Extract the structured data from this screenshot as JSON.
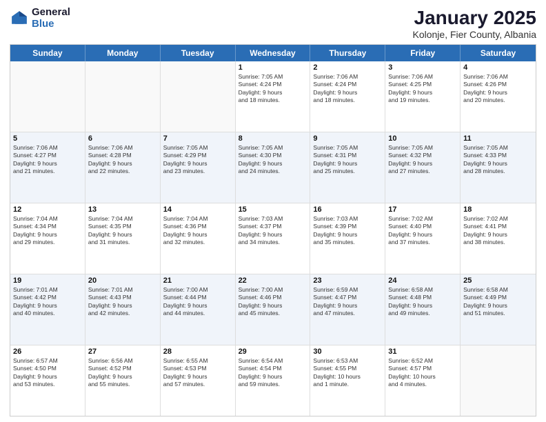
{
  "logo": {
    "general": "General",
    "blue": "Blue"
  },
  "header": {
    "month": "January 2025",
    "location": "Kolonje, Fier County, Albania"
  },
  "weekdays": [
    "Sunday",
    "Monday",
    "Tuesday",
    "Wednesday",
    "Thursday",
    "Friday",
    "Saturday"
  ],
  "rows": [
    {
      "alt": false,
      "cells": [
        {
          "day": "",
          "info": ""
        },
        {
          "day": "",
          "info": ""
        },
        {
          "day": "",
          "info": ""
        },
        {
          "day": "1",
          "info": "Sunrise: 7:05 AM\nSunset: 4:24 PM\nDaylight: 9 hours\nand 18 minutes."
        },
        {
          "day": "2",
          "info": "Sunrise: 7:06 AM\nSunset: 4:24 PM\nDaylight: 9 hours\nand 18 minutes."
        },
        {
          "day": "3",
          "info": "Sunrise: 7:06 AM\nSunset: 4:25 PM\nDaylight: 9 hours\nand 19 minutes."
        },
        {
          "day": "4",
          "info": "Sunrise: 7:06 AM\nSunset: 4:26 PM\nDaylight: 9 hours\nand 20 minutes."
        }
      ]
    },
    {
      "alt": true,
      "cells": [
        {
          "day": "5",
          "info": "Sunrise: 7:06 AM\nSunset: 4:27 PM\nDaylight: 9 hours\nand 21 minutes."
        },
        {
          "day": "6",
          "info": "Sunrise: 7:06 AM\nSunset: 4:28 PM\nDaylight: 9 hours\nand 22 minutes."
        },
        {
          "day": "7",
          "info": "Sunrise: 7:05 AM\nSunset: 4:29 PM\nDaylight: 9 hours\nand 23 minutes."
        },
        {
          "day": "8",
          "info": "Sunrise: 7:05 AM\nSunset: 4:30 PM\nDaylight: 9 hours\nand 24 minutes."
        },
        {
          "day": "9",
          "info": "Sunrise: 7:05 AM\nSunset: 4:31 PM\nDaylight: 9 hours\nand 25 minutes."
        },
        {
          "day": "10",
          "info": "Sunrise: 7:05 AM\nSunset: 4:32 PM\nDaylight: 9 hours\nand 27 minutes."
        },
        {
          "day": "11",
          "info": "Sunrise: 7:05 AM\nSunset: 4:33 PM\nDaylight: 9 hours\nand 28 minutes."
        }
      ]
    },
    {
      "alt": false,
      "cells": [
        {
          "day": "12",
          "info": "Sunrise: 7:04 AM\nSunset: 4:34 PM\nDaylight: 9 hours\nand 29 minutes."
        },
        {
          "day": "13",
          "info": "Sunrise: 7:04 AM\nSunset: 4:35 PM\nDaylight: 9 hours\nand 31 minutes."
        },
        {
          "day": "14",
          "info": "Sunrise: 7:04 AM\nSunset: 4:36 PM\nDaylight: 9 hours\nand 32 minutes."
        },
        {
          "day": "15",
          "info": "Sunrise: 7:03 AM\nSunset: 4:37 PM\nDaylight: 9 hours\nand 34 minutes."
        },
        {
          "day": "16",
          "info": "Sunrise: 7:03 AM\nSunset: 4:39 PM\nDaylight: 9 hours\nand 35 minutes."
        },
        {
          "day": "17",
          "info": "Sunrise: 7:02 AM\nSunset: 4:40 PM\nDaylight: 9 hours\nand 37 minutes."
        },
        {
          "day": "18",
          "info": "Sunrise: 7:02 AM\nSunset: 4:41 PM\nDaylight: 9 hours\nand 38 minutes."
        }
      ]
    },
    {
      "alt": true,
      "cells": [
        {
          "day": "19",
          "info": "Sunrise: 7:01 AM\nSunset: 4:42 PM\nDaylight: 9 hours\nand 40 minutes."
        },
        {
          "day": "20",
          "info": "Sunrise: 7:01 AM\nSunset: 4:43 PM\nDaylight: 9 hours\nand 42 minutes."
        },
        {
          "day": "21",
          "info": "Sunrise: 7:00 AM\nSunset: 4:44 PM\nDaylight: 9 hours\nand 44 minutes."
        },
        {
          "day": "22",
          "info": "Sunrise: 7:00 AM\nSunset: 4:46 PM\nDaylight: 9 hours\nand 45 minutes."
        },
        {
          "day": "23",
          "info": "Sunrise: 6:59 AM\nSunset: 4:47 PM\nDaylight: 9 hours\nand 47 minutes."
        },
        {
          "day": "24",
          "info": "Sunrise: 6:58 AM\nSunset: 4:48 PM\nDaylight: 9 hours\nand 49 minutes."
        },
        {
          "day": "25",
          "info": "Sunrise: 6:58 AM\nSunset: 4:49 PM\nDaylight: 9 hours\nand 51 minutes."
        }
      ]
    },
    {
      "alt": false,
      "cells": [
        {
          "day": "26",
          "info": "Sunrise: 6:57 AM\nSunset: 4:50 PM\nDaylight: 9 hours\nand 53 minutes."
        },
        {
          "day": "27",
          "info": "Sunrise: 6:56 AM\nSunset: 4:52 PM\nDaylight: 9 hours\nand 55 minutes."
        },
        {
          "day": "28",
          "info": "Sunrise: 6:55 AM\nSunset: 4:53 PM\nDaylight: 9 hours\nand 57 minutes."
        },
        {
          "day": "29",
          "info": "Sunrise: 6:54 AM\nSunset: 4:54 PM\nDaylight: 9 hours\nand 59 minutes."
        },
        {
          "day": "30",
          "info": "Sunrise: 6:53 AM\nSunset: 4:55 PM\nDaylight: 10 hours\nand 1 minute."
        },
        {
          "day": "31",
          "info": "Sunrise: 6:52 AM\nSunset: 4:57 PM\nDaylight: 10 hours\nand 4 minutes."
        },
        {
          "day": "",
          "info": ""
        }
      ]
    }
  ]
}
